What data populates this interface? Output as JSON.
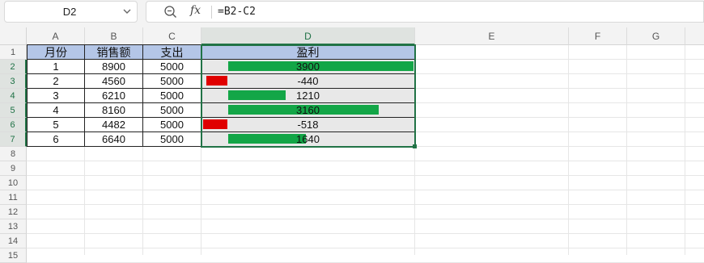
{
  "name_box": "D2",
  "formula": "=B2-C2",
  "fx_label": "fx",
  "columns": [
    "A",
    "B",
    "C",
    "D",
    "E",
    "F",
    "G"
  ],
  "rows": [
    "1",
    "2",
    "3",
    "4",
    "5",
    "6",
    "7",
    "8",
    "9",
    "10",
    "11",
    "12",
    "13",
    "14",
    "15"
  ],
  "table": {
    "headers": [
      "月份",
      "销售额",
      "支出",
      "盈利"
    ],
    "rows": [
      {
        "month": "1",
        "sales": "8900",
        "expense": "5000",
        "profit": "3900",
        "profit_num": 3900
      },
      {
        "month": "2",
        "sales": "4560",
        "expense": "5000",
        "profit": "-440",
        "profit_num": -440
      },
      {
        "month": "3",
        "sales": "6210",
        "expense": "5000",
        "profit": "1210",
        "profit_num": 1210
      },
      {
        "month": "4",
        "sales": "8160",
        "expense": "5000",
        "profit": "3160",
        "profit_num": 3160
      },
      {
        "month": "5",
        "sales": "4482",
        "expense": "5000",
        "profit": "-518",
        "profit_num": -518
      },
      {
        "month": "6",
        "sales": "6640",
        "expense": "5000",
        "profit": "1640",
        "profit_num": 1640
      }
    ]
  },
  "colors": {
    "positive_bar": "#13a647",
    "negative_bar": "#e00000",
    "header_fill": "#b4c6e7",
    "selection": "#217346"
  },
  "icons": {
    "zoom": "zoom-icon",
    "dropdown": "chevron-down-icon"
  }
}
